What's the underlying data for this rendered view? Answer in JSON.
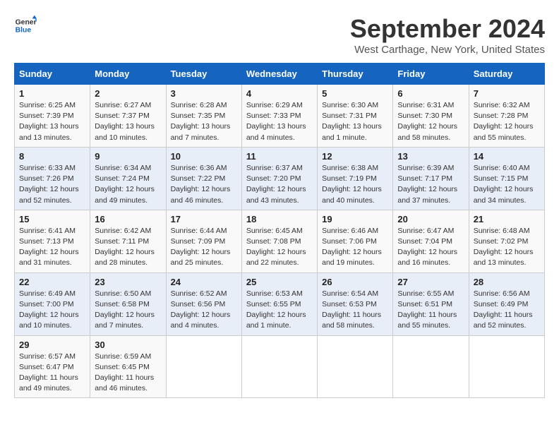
{
  "header": {
    "logo_line1": "General",
    "logo_line2": "Blue",
    "month_title": "September 2024",
    "location": "West Carthage, New York, United States"
  },
  "days_of_week": [
    "Sunday",
    "Monday",
    "Tuesday",
    "Wednesday",
    "Thursday",
    "Friday",
    "Saturday"
  ],
  "weeks": [
    [
      {
        "day": "1",
        "info": "Sunrise: 6:25 AM\nSunset: 7:39 PM\nDaylight: 13 hours\nand 13 minutes."
      },
      {
        "day": "2",
        "info": "Sunrise: 6:27 AM\nSunset: 7:37 PM\nDaylight: 13 hours\nand 10 minutes."
      },
      {
        "day": "3",
        "info": "Sunrise: 6:28 AM\nSunset: 7:35 PM\nDaylight: 13 hours\nand 7 minutes."
      },
      {
        "day": "4",
        "info": "Sunrise: 6:29 AM\nSunset: 7:33 PM\nDaylight: 13 hours\nand 4 minutes."
      },
      {
        "day": "5",
        "info": "Sunrise: 6:30 AM\nSunset: 7:31 PM\nDaylight: 13 hours\nand 1 minute."
      },
      {
        "day": "6",
        "info": "Sunrise: 6:31 AM\nSunset: 7:30 PM\nDaylight: 12 hours\nand 58 minutes."
      },
      {
        "day": "7",
        "info": "Sunrise: 6:32 AM\nSunset: 7:28 PM\nDaylight: 12 hours\nand 55 minutes."
      }
    ],
    [
      {
        "day": "8",
        "info": "Sunrise: 6:33 AM\nSunset: 7:26 PM\nDaylight: 12 hours\nand 52 minutes."
      },
      {
        "day": "9",
        "info": "Sunrise: 6:34 AM\nSunset: 7:24 PM\nDaylight: 12 hours\nand 49 minutes."
      },
      {
        "day": "10",
        "info": "Sunrise: 6:36 AM\nSunset: 7:22 PM\nDaylight: 12 hours\nand 46 minutes."
      },
      {
        "day": "11",
        "info": "Sunrise: 6:37 AM\nSunset: 7:20 PM\nDaylight: 12 hours\nand 43 minutes."
      },
      {
        "day": "12",
        "info": "Sunrise: 6:38 AM\nSunset: 7:19 PM\nDaylight: 12 hours\nand 40 minutes."
      },
      {
        "day": "13",
        "info": "Sunrise: 6:39 AM\nSunset: 7:17 PM\nDaylight: 12 hours\nand 37 minutes."
      },
      {
        "day": "14",
        "info": "Sunrise: 6:40 AM\nSunset: 7:15 PM\nDaylight: 12 hours\nand 34 minutes."
      }
    ],
    [
      {
        "day": "15",
        "info": "Sunrise: 6:41 AM\nSunset: 7:13 PM\nDaylight: 12 hours\nand 31 minutes."
      },
      {
        "day": "16",
        "info": "Sunrise: 6:42 AM\nSunset: 7:11 PM\nDaylight: 12 hours\nand 28 minutes."
      },
      {
        "day": "17",
        "info": "Sunrise: 6:44 AM\nSunset: 7:09 PM\nDaylight: 12 hours\nand 25 minutes."
      },
      {
        "day": "18",
        "info": "Sunrise: 6:45 AM\nSunset: 7:08 PM\nDaylight: 12 hours\nand 22 minutes."
      },
      {
        "day": "19",
        "info": "Sunrise: 6:46 AM\nSunset: 7:06 PM\nDaylight: 12 hours\nand 19 minutes."
      },
      {
        "day": "20",
        "info": "Sunrise: 6:47 AM\nSunset: 7:04 PM\nDaylight: 12 hours\nand 16 minutes."
      },
      {
        "day": "21",
        "info": "Sunrise: 6:48 AM\nSunset: 7:02 PM\nDaylight: 12 hours\nand 13 minutes."
      }
    ],
    [
      {
        "day": "22",
        "info": "Sunrise: 6:49 AM\nSunset: 7:00 PM\nDaylight: 12 hours\nand 10 minutes."
      },
      {
        "day": "23",
        "info": "Sunrise: 6:50 AM\nSunset: 6:58 PM\nDaylight: 12 hours\nand 7 minutes."
      },
      {
        "day": "24",
        "info": "Sunrise: 6:52 AM\nSunset: 6:56 PM\nDaylight: 12 hours\nand 4 minutes."
      },
      {
        "day": "25",
        "info": "Sunrise: 6:53 AM\nSunset: 6:55 PM\nDaylight: 12 hours\nand 1 minute."
      },
      {
        "day": "26",
        "info": "Sunrise: 6:54 AM\nSunset: 6:53 PM\nDaylight: 11 hours\nand 58 minutes."
      },
      {
        "day": "27",
        "info": "Sunrise: 6:55 AM\nSunset: 6:51 PM\nDaylight: 11 hours\nand 55 minutes."
      },
      {
        "day": "28",
        "info": "Sunrise: 6:56 AM\nSunset: 6:49 PM\nDaylight: 11 hours\nand 52 minutes."
      }
    ],
    [
      {
        "day": "29",
        "info": "Sunrise: 6:57 AM\nSunset: 6:47 PM\nDaylight: 11 hours\nand 49 minutes."
      },
      {
        "day": "30",
        "info": "Sunrise: 6:59 AM\nSunset: 6:45 PM\nDaylight: 11 hours\nand 46 minutes."
      },
      null,
      null,
      null,
      null,
      null
    ]
  ]
}
